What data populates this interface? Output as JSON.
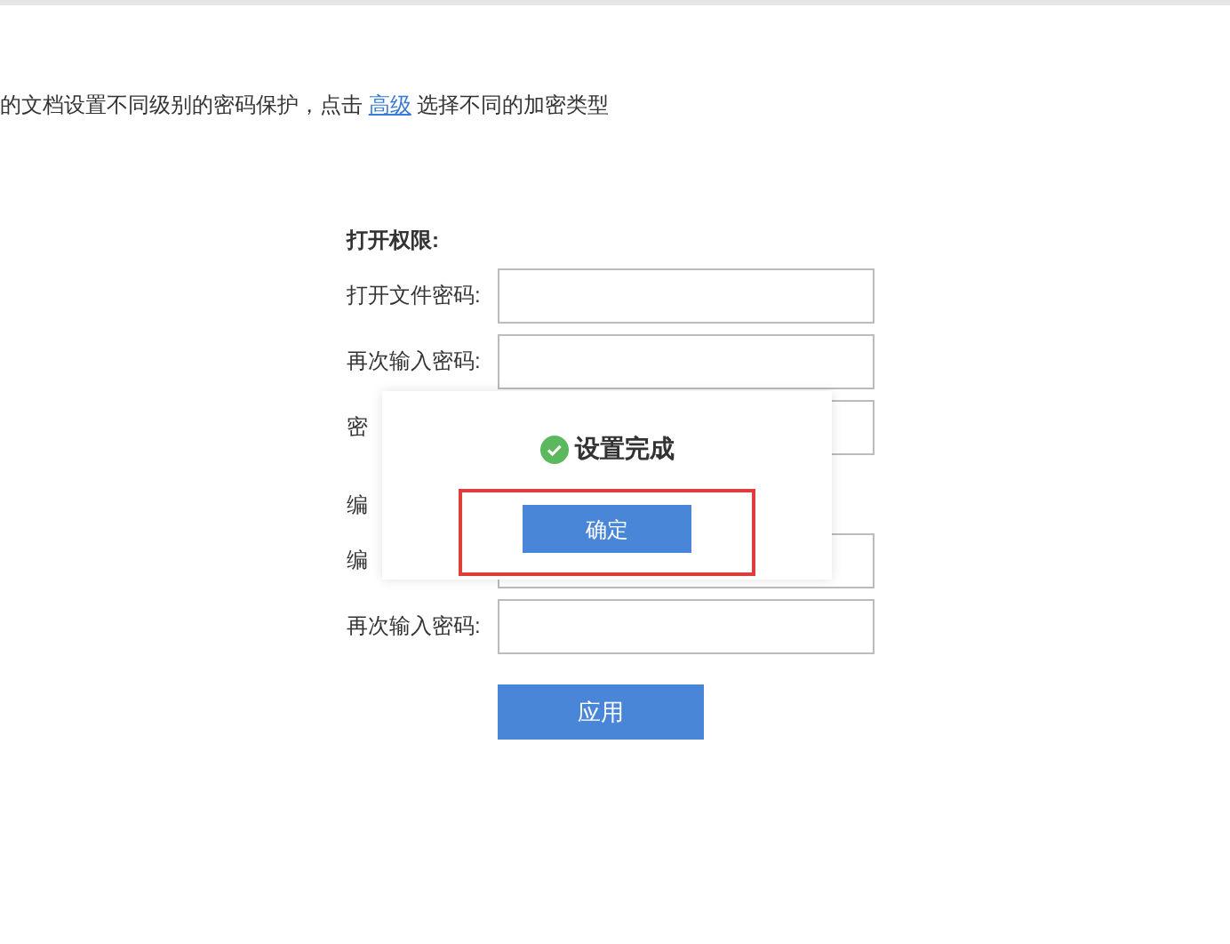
{
  "intro": {
    "text_before": "的文档设置不同级别的密码保护，点击",
    "link": "高级",
    "text_after": "选择不同的加密类型"
  },
  "open_section": {
    "heading": "打开权限:",
    "rows": [
      {
        "label": "打开文件密码:"
      },
      {
        "label": "再次输入密码:"
      },
      {
        "label": "密"
      }
    ]
  },
  "edit_section": {
    "heading": "编",
    "rows": [
      {
        "label": "编"
      },
      {
        "label": "再次输入密码:"
      }
    ]
  },
  "apply_button": "应用",
  "dialog": {
    "title": "设置完成",
    "confirm_button": "确定",
    "highlighted": true
  }
}
